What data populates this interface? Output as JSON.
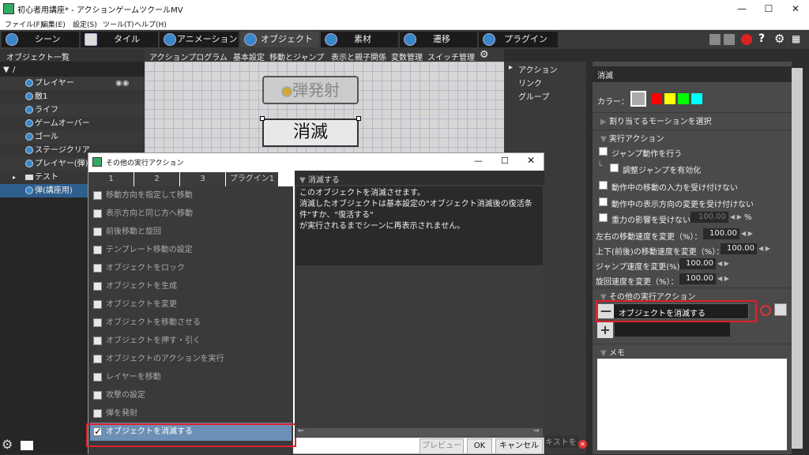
{
  "window": {
    "title": "初心者用講座* - アクションゲームツクールMV"
  },
  "menu": [
    "ファイル(F)",
    "編集(E)",
    "設定(S)",
    "ツール(T)",
    "ヘルプ(H)"
  ],
  "tabs": [
    "シーン",
    "タイル",
    "アニメーション",
    "オブジェクト",
    "素材",
    "遷移",
    "プラグイン"
  ],
  "object_list": {
    "header": "オブジェクト一覧",
    "root": "/",
    "items": [
      "プレイヤー",
      "敵1",
      "ライフ",
      "ゲームオーバー",
      "ゴール",
      "ステージクリア",
      "プレイヤー(弾)",
      "テスト",
      "弾(講座用)"
    ]
  },
  "subtabs": [
    "アクションプログラム",
    "基本設定",
    "移動とジャンプ",
    "表示と親子関係",
    "変数管理",
    "スイッチ管理"
  ],
  "canvas": {
    "node1": "弾発射",
    "node2": "消滅"
  },
  "links": [
    "アクション",
    "リンク",
    "グループ"
  ],
  "right_panel": {
    "title": "消滅",
    "color_label": "カラー：",
    "colors": [
      "#aaaaaa",
      "#ff0000",
      "#ffff00",
      "#00ff00",
      "#00ffff"
    ],
    "motion_section": "割り当てるモーションを選択",
    "exec_section": "実行アクション",
    "jump": "ジャンプ動作を行う",
    "adjust_jump": "調整ジャンプを有効化",
    "no_move_input": "動作中の移動の入力を受け付けない",
    "no_dir_change": "動作中の表示方向の変更を受け付けない",
    "no_gravity": "重力の影響を受けない",
    "gravity_value": "100.00",
    "percent": "%",
    "lr_speed": "左右の移動速度を変更（%）：",
    "lr_value": "100.00",
    "ud_speed": "上下(前後)の移動速度を変更（%）：",
    "ud_value": "100.00",
    "jump_speed": "ジャンプ速度を変更(%)：",
    "jump_value": "100.00",
    "turn_speed": "旋回速度を変更（%）：",
    "turn_value": "100.00",
    "other_section": "その他の実行アクション",
    "other_item": "オブジェクトを消滅する",
    "memo_section": "メモ"
  },
  "dialog": {
    "title": "その他の実行アクション",
    "tabs": [
      "1",
      "2",
      "3",
      "プラグイン1"
    ],
    "items": [
      "移動方向を指定して移動",
      "表示方向と同じ方へ移動",
      "前後移動と旋回",
      "テンプレート移動の設定",
      "オブジェクトをロック",
      "オブジェクトを生成",
      "オブジェクトを変更",
      "オブジェクトを移動させる",
      "オブジェクトを押す・引く",
      "オブジェクトのアクションを実行",
      "レイヤーを移動",
      "攻撃の設定",
      "弾を発射",
      "オブジェクトを消滅する"
    ],
    "selected_check": "✓",
    "desc_title": "消滅する",
    "desc_text": "このオブジェクトを消滅させます。\n消滅したオブジェクトは基本設定の\"オブジェクト消滅後の復活条件\"すか、\"復活する\"\nが実行されるまでシーンに再表示されません。",
    "preview": "プレビュー",
    "ok": "OK",
    "cancel": "キャンセル"
  },
  "bottom_partial": "キストを"
}
